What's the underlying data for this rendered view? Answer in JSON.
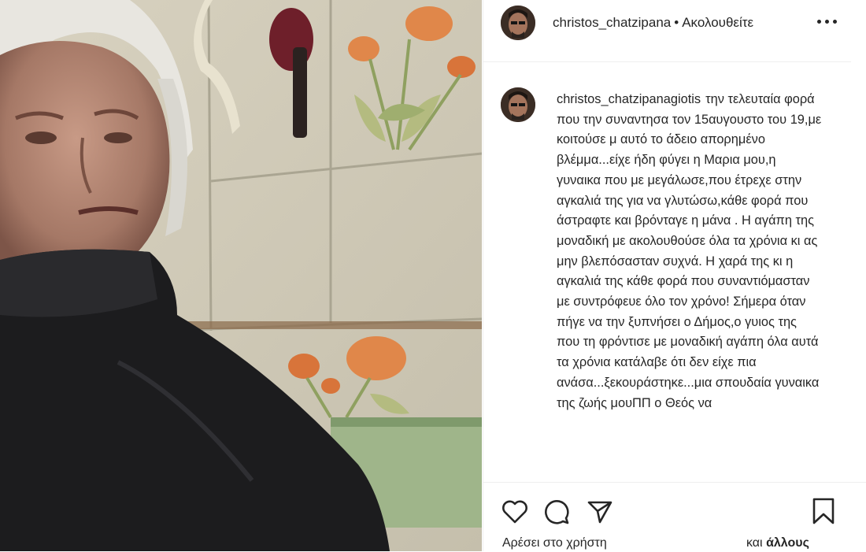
{
  "post": {
    "username": "christos_chatzipana",
    "separator": "•",
    "follow_label": "Ακολουθείτε"
  },
  "comment": {
    "author": "christos_chatzipanagiotis",
    "text": "την τελευταία φορά που την συναντησα τον 15αυγουστο του 19,με κοιτούσε μ αυτό το άδειο απορημένο βλέμμα...είχε ήδη φύγει η Μαρια μου,η γυναικα που με μεγάλωσε,που έτρεχε στην αγκαλιά της για να γλυτώσω,κάθε φορά που άστραφτε και βρόνταγε η μάνα . Η αγάπη της μοναδική με ακολουθούσε όλα τα χρόνια κι ας μην βλεπόσασταν συχνά. Η χαρά της κι η αγκαλιά της κάθε φορά που συναντιόμασταν με συντρόφευε όλο τον χρόνο! Σήμερα όταν πήγε να την ξυπνήσει ο Δήμος,ο γυιος της που τη φρόντισε με μοναδική αγάπη όλα αυτά τα χρόνια κατάλαβε ότι δεν είχε πια ανάσα...ξεκουράστηκε...μια σπουδαία γυναικα της ζωής μουΠΠ ο Θεός να"
  },
  "likes": {
    "left_text": "Αρέσει στο χρήστη",
    "right_prefix": "και",
    "right_bold": "άλλους"
  },
  "icons": [
    "more-icon",
    "heart-icon",
    "comment-icon",
    "share-icon",
    "bookmark-icon"
  ]
}
